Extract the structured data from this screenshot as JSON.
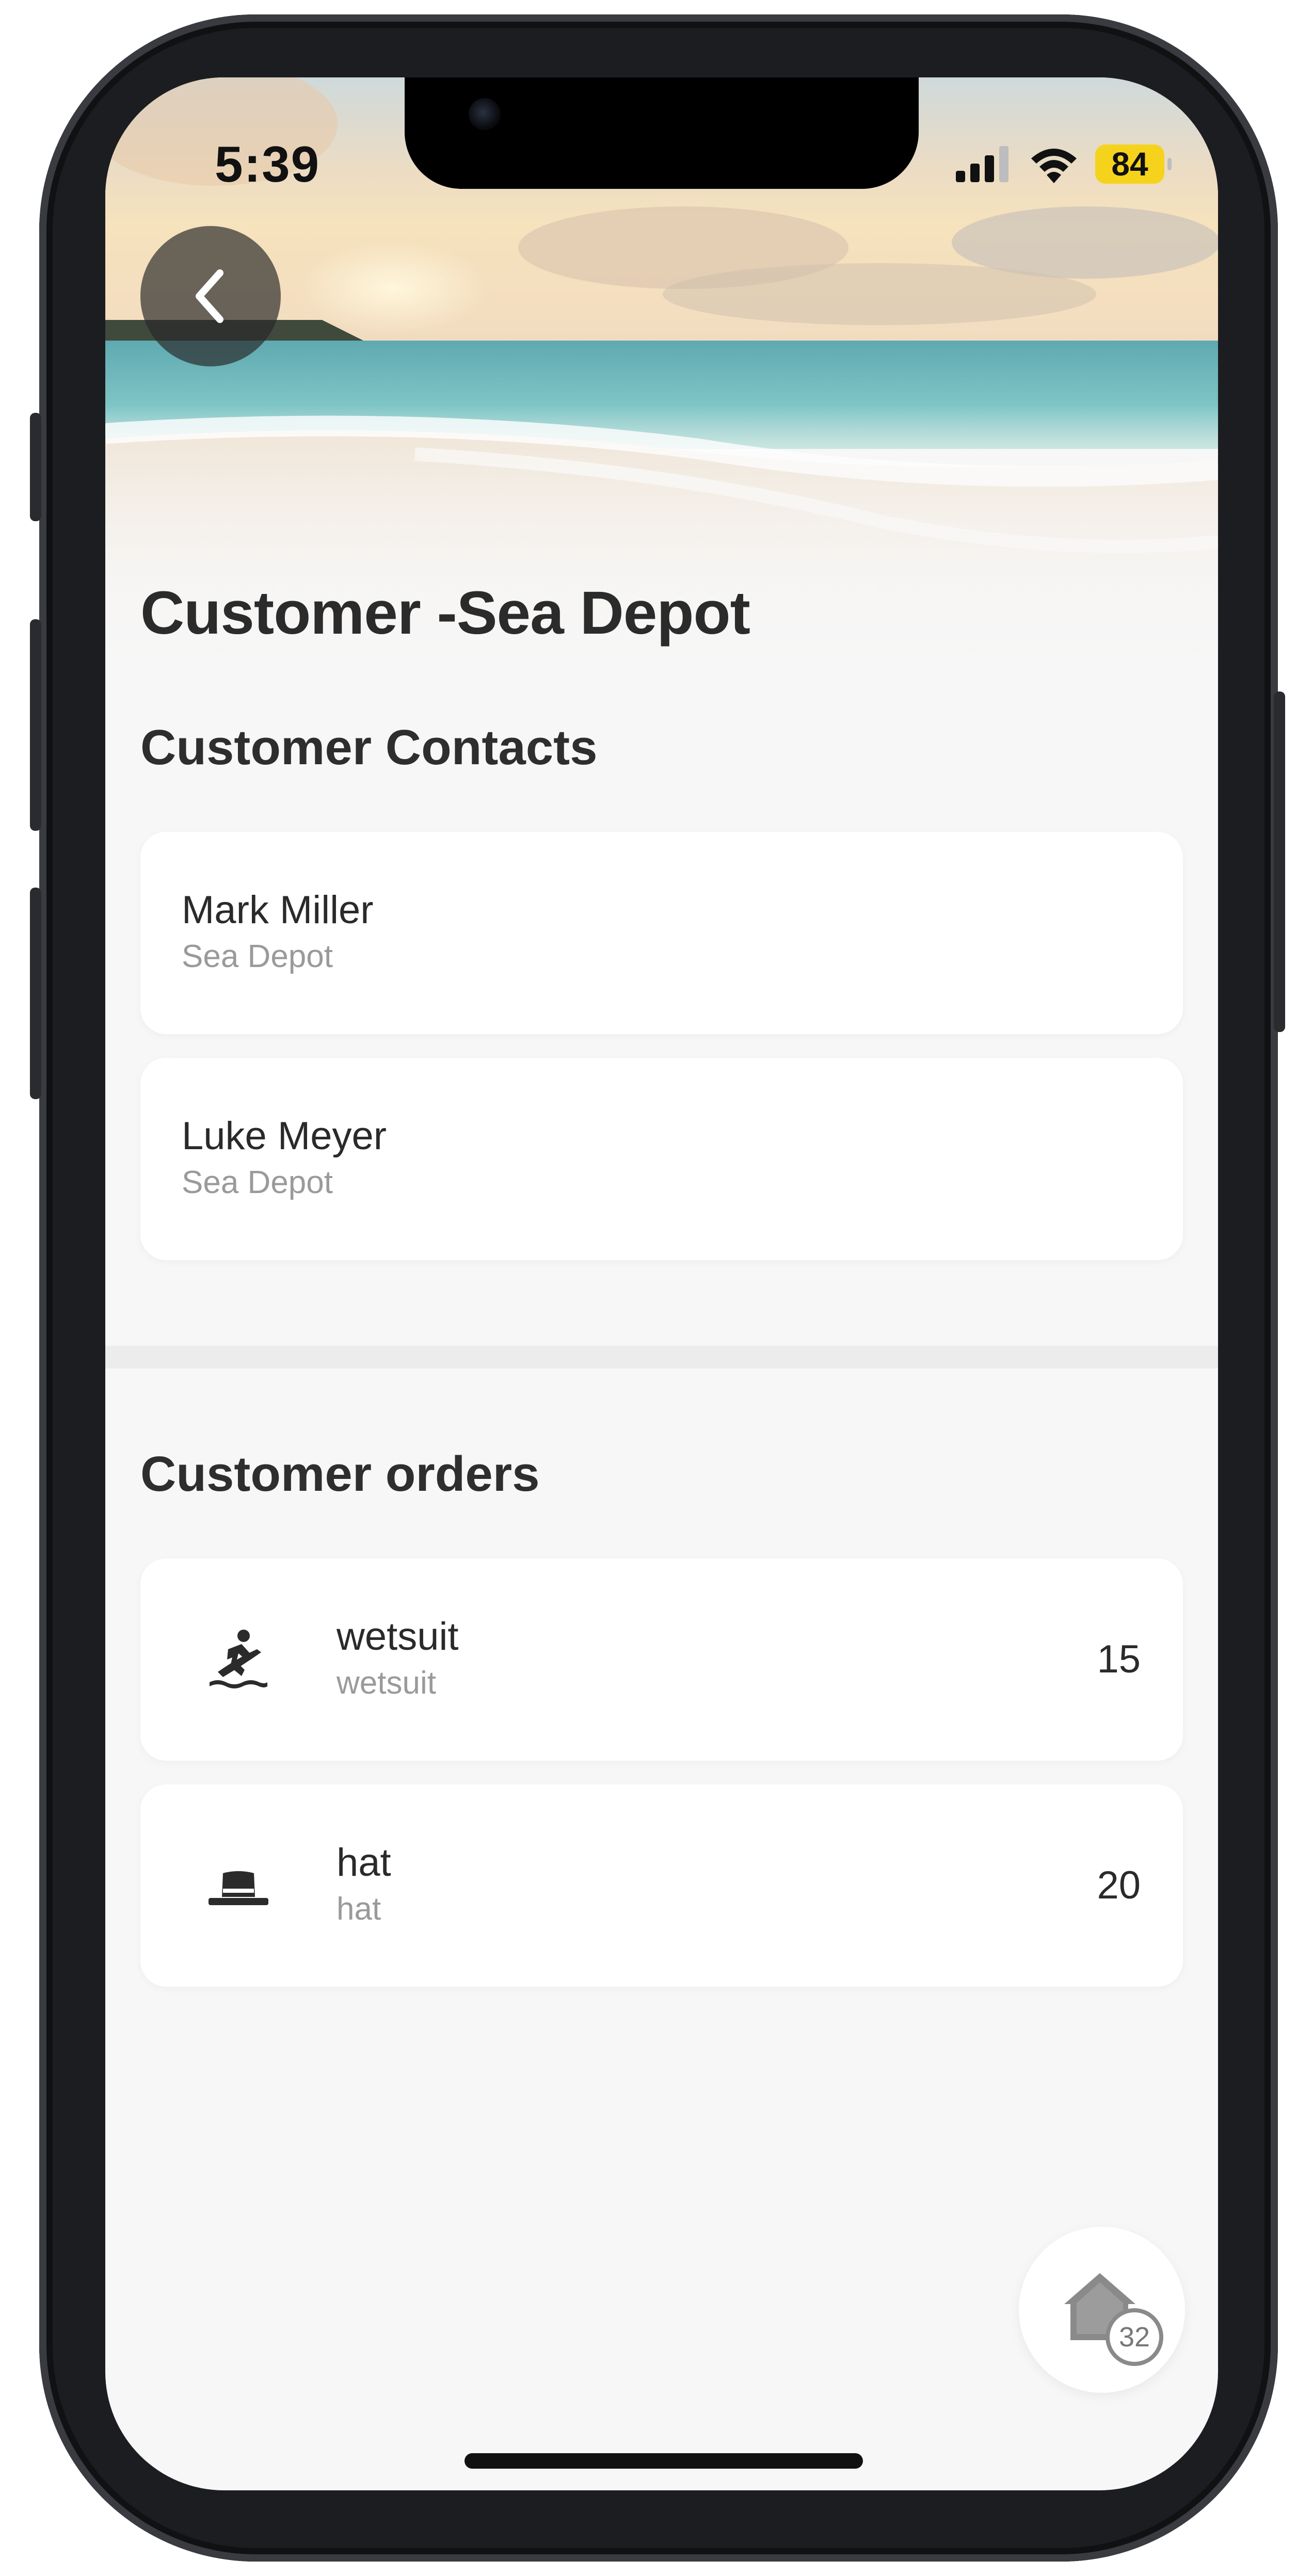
{
  "status_bar": {
    "time": "5:39",
    "battery": "84"
  },
  "header": {
    "title": "Customer -Sea Depot"
  },
  "contacts": {
    "title": "Customer Contacts",
    "items": [
      {
        "name": "Mark Miller",
        "company": "Sea Depot"
      },
      {
        "name": "Luke Meyer",
        "company": "Sea Depot"
      }
    ]
  },
  "orders": {
    "title": "Customer orders",
    "items": [
      {
        "icon": "surfing-icon",
        "name": "wetsuit",
        "subtitle": "wetsuit",
        "quantity": "15"
      },
      {
        "icon": "hat-icon",
        "name": "hat",
        "subtitle": "hat",
        "quantity": "20"
      }
    ]
  },
  "home_fab": {
    "icon": "home-icon",
    "badge": "32"
  },
  "colors": {
    "battery": "#f5d31c",
    "background": "#f7f7f7",
    "text": "#2b2b2b",
    "muted": "#9a9a9a"
  }
}
